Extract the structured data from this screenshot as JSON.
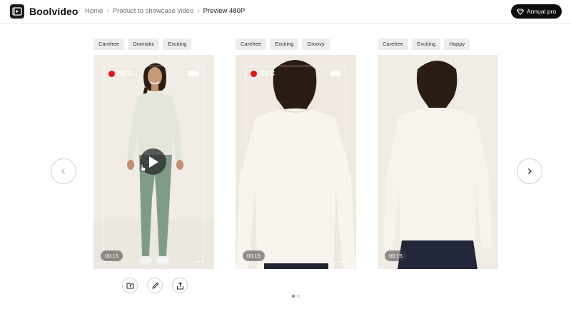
{
  "app": {
    "brand": "Boolvideo"
  },
  "breadcrumb": [
    "Home",
    "Product to showcase video",
    "Preview 480P"
  ],
  "header": {
    "pro_button_label": "Annual pro"
  },
  "cards": [
    {
      "tags": [
        "Carefree",
        "Dramatic",
        "Exciting"
      ],
      "duration": "00:15",
      "rec_label": "REC"
    },
    {
      "tags": [
        "Carefree",
        "Exciting",
        "Groovy"
      ],
      "duration": "00:15",
      "rec_label": "REC"
    },
    {
      "tags": [
        "Carefree",
        "Exciting",
        "Happy"
      ],
      "duration": "00:15",
      "rec_label": ""
    }
  ],
  "card_actions": [
    "folder-icon",
    "pencil-icon",
    "share-icon"
  ],
  "pagination": {
    "total": 2,
    "current": 1
  },
  "colors": {
    "rec": "#e5141b",
    "primary_button": "#0d0d0d",
    "tag_bg": "#ededed"
  }
}
